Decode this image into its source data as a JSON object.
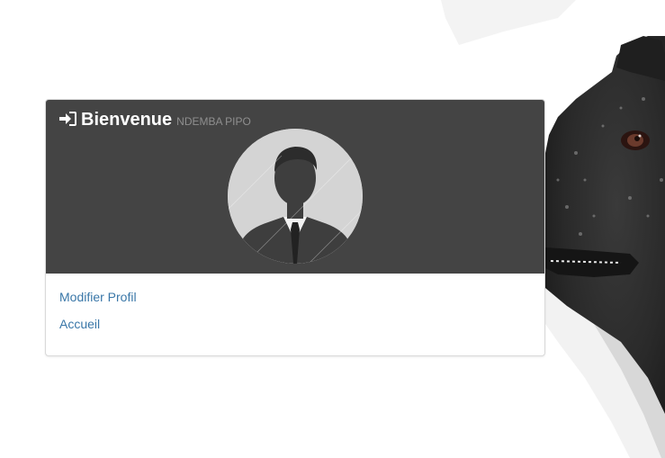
{
  "panel": {
    "title": "Bienvenue",
    "username": "NDEMBA PIPO"
  },
  "links": {
    "edit_profile": "Modifier Profil",
    "home": "Accueil"
  },
  "icons": {
    "title_icon": "sign-in-icon",
    "avatar": "user-silhouette-avatar"
  },
  "colors": {
    "header_bg": "#444444",
    "link": "#3a77a8",
    "title": "#ffffff",
    "username": "#8f8f8f"
  }
}
